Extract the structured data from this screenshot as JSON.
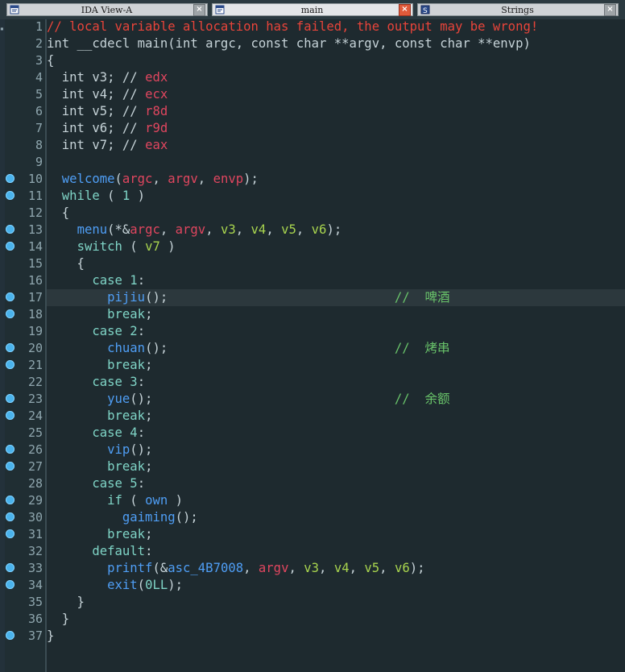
{
  "tabs": [
    {
      "label": "IDA View-A",
      "icon": "disassembly-view-icon",
      "close_style": "grey"
    },
    {
      "label": "main",
      "icon": "pseudocode-view-icon",
      "close_style": "red"
    },
    {
      "label": "Strings",
      "icon": "strings-view-icon",
      "close_style": "grey"
    }
  ],
  "colors": {
    "background": "#1e2a2f",
    "keyword": "#7fd4c6",
    "function": "#4f9ef5",
    "argument": "#e0465f",
    "local": "#a8d44e",
    "warning_comment": "#e8443a",
    "user_comment": "#69c36a",
    "breakpoint": "#4ab3ec"
  },
  "highlighted_line": 17,
  "lines": [
    {
      "n": "1",
      "bp": false,
      "tokens": [
        [
          "cmt",
          "// local variable allocation has failed, the output may be wrong!"
        ]
      ]
    },
    {
      "n": "2",
      "bp": false,
      "tokens": [
        [
          "plain",
          "int __cdecl main(int argc, const char **argv, const char **envp)"
        ]
      ]
    },
    {
      "n": "3",
      "bp": false,
      "tokens": [
        [
          "plain",
          "{"
        ]
      ]
    },
    {
      "n": "4",
      "bp": false,
      "tokens": [
        [
          "plain",
          "  int v3; // "
        ],
        [
          "reg",
          "edx"
        ]
      ]
    },
    {
      "n": "5",
      "bp": false,
      "tokens": [
        [
          "plain",
          "  int v4; // "
        ],
        [
          "reg",
          "ecx"
        ]
      ]
    },
    {
      "n": "6",
      "bp": false,
      "tokens": [
        [
          "plain",
          "  int v5; // "
        ],
        [
          "reg",
          "r8d"
        ]
      ]
    },
    {
      "n": "7",
      "bp": false,
      "tokens": [
        [
          "plain",
          "  int v6; // "
        ],
        [
          "reg",
          "r9d"
        ]
      ]
    },
    {
      "n": "8",
      "bp": false,
      "tokens": [
        [
          "plain",
          "  int v7; // "
        ],
        [
          "reg",
          "eax"
        ]
      ]
    },
    {
      "n": "9",
      "bp": false,
      "tokens": []
    },
    {
      "n": "10",
      "bp": true,
      "tokens": [
        [
          "plain",
          "  "
        ],
        [
          "fn",
          "welcome"
        ],
        [
          "plain",
          "("
        ],
        [
          "var",
          "argc"
        ],
        [
          "plain",
          ", "
        ],
        [
          "var",
          "argv"
        ],
        [
          "plain",
          ", "
        ],
        [
          "var",
          "envp"
        ],
        [
          "plain",
          ");"
        ]
      ]
    },
    {
      "n": "11",
      "bp": true,
      "tokens": [
        [
          "plain",
          "  "
        ],
        [
          "kw",
          "while"
        ],
        [
          "plain",
          " ( "
        ],
        [
          "kw",
          "1"
        ],
        [
          "plain",
          " )"
        ]
      ]
    },
    {
      "n": "12",
      "bp": false,
      "tokens": [
        [
          "plain",
          "  {"
        ]
      ]
    },
    {
      "n": "13",
      "bp": true,
      "tokens": [
        [
          "plain",
          "    "
        ],
        [
          "fn",
          "menu"
        ],
        [
          "plain",
          "(*&"
        ],
        [
          "var",
          "argc"
        ],
        [
          "plain",
          ", "
        ],
        [
          "var",
          "argv"
        ],
        [
          "plain",
          ", "
        ],
        [
          "loc",
          "v3"
        ],
        [
          "plain",
          ", "
        ],
        [
          "loc",
          "v4"
        ],
        [
          "plain",
          ", "
        ],
        [
          "loc",
          "v5"
        ],
        [
          "plain",
          ", "
        ],
        [
          "loc",
          "v6"
        ],
        [
          "plain",
          ");"
        ]
      ]
    },
    {
      "n": "14",
      "bp": true,
      "tokens": [
        [
          "plain",
          "    "
        ],
        [
          "kw",
          "switch"
        ],
        [
          "plain",
          " ( "
        ],
        [
          "loc",
          "v7"
        ],
        [
          "plain",
          " )"
        ]
      ]
    },
    {
      "n": "15",
      "bp": false,
      "tokens": [
        [
          "plain",
          "    {"
        ]
      ]
    },
    {
      "n": "16",
      "bp": false,
      "tokens": [
        [
          "plain",
          "      "
        ],
        [
          "kw",
          "case 1"
        ],
        [
          "plain",
          ":"
        ]
      ]
    },
    {
      "n": "17",
      "bp": true,
      "tokens": [
        [
          "plain",
          "        "
        ],
        [
          "fn",
          "pijiu"
        ],
        [
          "plain",
          "();"
        ],
        [
          "plain",
          "                              "
        ],
        [
          "cmt2",
          "//  啤酒"
        ]
      ]
    },
    {
      "n": "18",
      "bp": true,
      "tokens": [
        [
          "plain",
          "        "
        ],
        [
          "kw",
          "break"
        ],
        [
          "plain",
          ";"
        ]
      ]
    },
    {
      "n": "19",
      "bp": false,
      "tokens": [
        [
          "plain",
          "      "
        ],
        [
          "kw",
          "case 2"
        ],
        [
          "plain",
          ":"
        ]
      ]
    },
    {
      "n": "20",
      "bp": true,
      "tokens": [
        [
          "plain",
          "        "
        ],
        [
          "fn",
          "chuan"
        ],
        [
          "plain",
          "();"
        ],
        [
          "plain",
          "                              "
        ],
        [
          "cmt2",
          "//  烤串"
        ]
      ]
    },
    {
      "n": "21",
      "bp": true,
      "tokens": [
        [
          "plain",
          "        "
        ],
        [
          "kw",
          "break"
        ],
        [
          "plain",
          ";"
        ]
      ]
    },
    {
      "n": "22",
      "bp": false,
      "tokens": [
        [
          "plain",
          "      "
        ],
        [
          "kw",
          "case 3"
        ],
        [
          "plain",
          ":"
        ]
      ]
    },
    {
      "n": "23",
      "bp": true,
      "tokens": [
        [
          "plain",
          "        "
        ],
        [
          "fn",
          "yue"
        ],
        [
          "plain",
          "();"
        ],
        [
          "plain",
          "                                "
        ],
        [
          "cmt2",
          "//  余额"
        ]
      ]
    },
    {
      "n": "24",
      "bp": true,
      "tokens": [
        [
          "plain",
          "        "
        ],
        [
          "kw",
          "break"
        ],
        [
          "plain",
          ";"
        ]
      ]
    },
    {
      "n": "25",
      "bp": false,
      "tokens": [
        [
          "plain",
          "      "
        ],
        [
          "kw",
          "case 4"
        ],
        [
          "plain",
          ":"
        ]
      ]
    },
    {
      "n": "26",
      "bp": true,
      "tokens": [
        [
          "plain",
          "        "
        ],
        [
          "fn",
          "vip"
        ],
        [
          "plain",
          "();"
        ]
      ]
    },
    {
      "n": "27",
      "bp": true,
      "tokens": [
        [
          "plain",
          "        "
        ],
        [
          "kw",
          "break"
        ],
        [
          "plain",
          ";"
        ]
      ]
    },
    {
      "n": "28",
      "bp": false,
      "tokens": [
        [
          "plain",
          "      "
        ],
        [
          "kw",
          "case 5"
        ],
        [
          "plain",
          ":"
        ]
      ]
    },
    {
      "n": "29",
      "bp": true,
      "tokens": [
        [
          "plain",
          "        "
        ],
        [
          "kw",
          "if"
        ],
        [
          "plain",
          " ( "
        ],
        [
          "fn",
          "own"
        ],
        [
          "plain",
          " )"
        ]
      ]
    },
    {
      "n": "30",
      "bp": true,
      "tokens": [
        [
          "plain",
          "          "
        ],
        [
          "fn",
          "gaiming"
        ],
        [
          "plain",
          "();"
        ]
      ]
    },
    {
      "n": "31",
      "bp": true,
      "tokens": [
        [
          "plain",
          "        "
        ],
        [
          "kw",
          "break"
        ],
        [
          "plain",
          ";"
        ]
      ]
    },
    {
      "n": "32",
      "bp": false,
      "tokens": [
        [
          "plain",
          "      "
        ],
        [
          "kw",
          "default"
        ],
        [
          "plain",
          ":"
        ]
      ]
    },
    {
      "n": "33",
      "bp": true,
      "tokens": [
        [
          "plain",
          "        "
        ],
        [
          "fn",
          "printf"
        ],
        [
          "plain",
          "(&"
        ],
        [
          "fn",
          "asc_4B7008"
        ],
        [
          "plain",
          ", "
        ],
        [
          "var",
          "argv"
        ],
        [
          "plain",
          ", "
        ],
        [
          "loc",
          "v3"
        ],
        [
          "plain",
          ", "
        ],
        [
          "loc",
          "v4"
        ],
        [
          "plain",
          ", "
        ],
        [
          "loc",
          "v5"
        ],
        [
          "plain",
          ", "
        ],
        [
          "loc",
          "v6"
        ],
        [
          "plain",
          ");"
        ]
      ]
    },
    {
      "n": "34",
      "bp": true,
      "tokens": [
        [
          "plain",
          "        "
        ],
        [
          "fn",
          "exit"
        ],
        [
          "plain",
          "("
        ],
        [
          "kw",
          "0LL"
        ],
        [
          "plain",
          ");"
        ]
      ]
    },
    {
      "n": "35",
      "bp": false,
      "tokens": [
        [
          "plain",
          "    }"
        ]
      ]
    },
    {
      "n": "36",
      "bp": false,
      "tokens": [
        [
          "plain",
          "  }"
        ]
      ]
    },
    {
      "n": "37",
      "bp": true,
      "tokens": [
        [
          "plain",
          "}"
        ]
      ]
    }
  ]
}
